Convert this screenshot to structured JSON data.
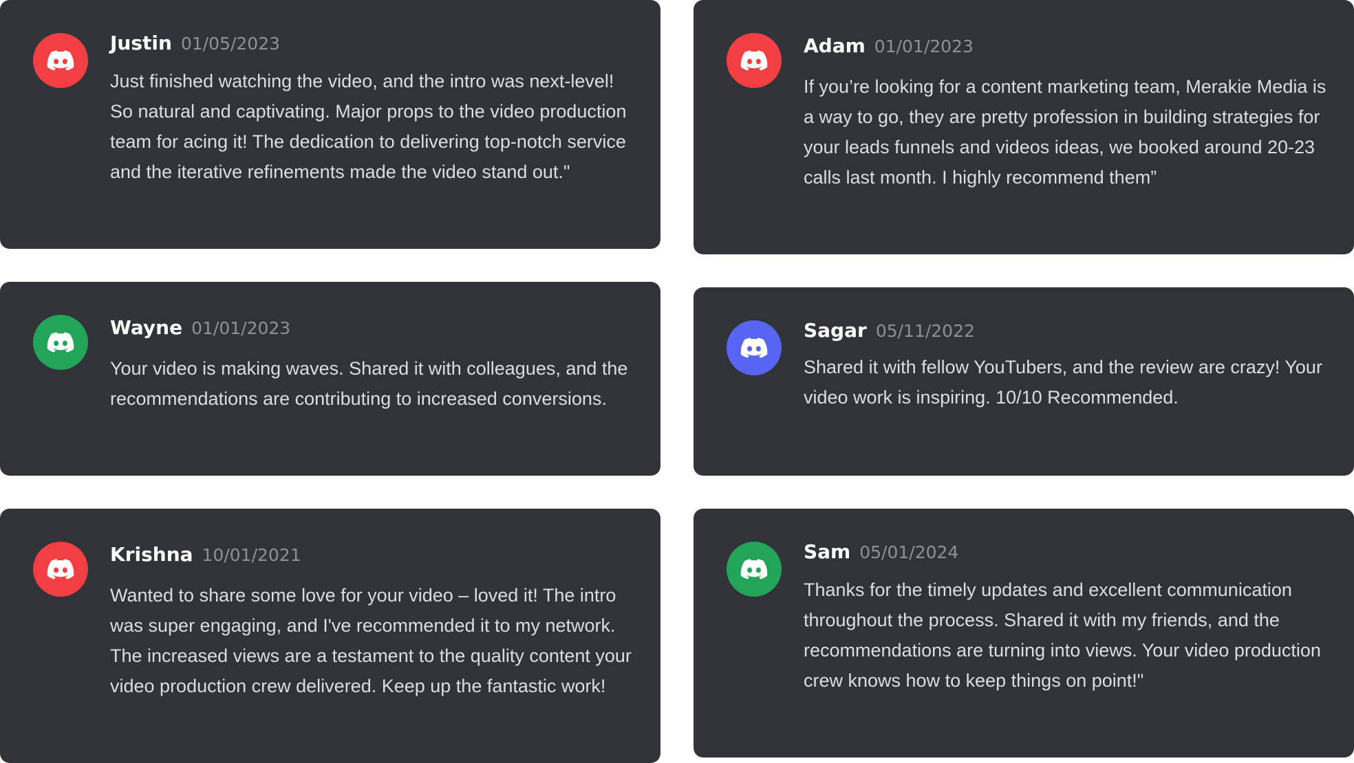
{
  "colors": {
    "card_background": "#313338",
    "username": "#ffffff",
    "timestamp": "#8e9297",
    "message_text": "#dbdee1",
    "avatar_red": "#f23f43",
    "avatar_green": "#23a559",
    "avatar_blurple": "#5865f2"
  },
  "avatar_icon": "discord-logo-icon",
  "reviews": [
    {
      "name": "Justin",
      "date": "01/05/2023",
      "avatar_color": "red",
      "message": "Just finished watching the video, and the intro was next-level! So natural and captivating. Major props to the video production team for acing it! The dedication to delivering top-notch service and the iterative refinements made the video stand out.\""
    },
    {
      "name": "Adam",
      "date": "01/01/2023",
      "avatar_color": "red",
      "message": "If you’re looking for a content marketing team, Merakie Media is a way to go, they are pretty profession in building strategies for your leads funnels and videos ideas, we booked around 20-23 calls last month. I highly recommend them”"
    },
    {
      "name": "Wayne",
      "date": "01/01/2023",
      "avatar_color": "green",
      "message": "Your video is making waves. Shared it with colleagues, and the recommendations are contributing to increased conversions."
    },
    {
      "name": "Sagar",
      "date": "05/11/2022",
      "avatar_color": "blurple",
      "message": "Shared it with fellow YouTubers, and the review are crazy! Your video work is inspiring. 10/10 Recommended."
    },
    {
      "name": "Krishna",
      "date": "10/01/2021",
      "avatar_color": "red",
      "message": "Wanted to share some love for your video – loved it! The intro was super engaging, and I've recommended it to my network. The increased views are a testament to the quality content your video production crew delivered. Keep up the fantastic work!"
    },
    {
      "name": "Sam",
      "date": "05/01/2024",
      "avatar_color": "green",
      "message": "Thanks for the timely updates and excellent communication throughout the process. Shared it with my friends, and the recommendations are turning into views. Your video production crew knows how to keep things on point!\""
    }
  ]
}
